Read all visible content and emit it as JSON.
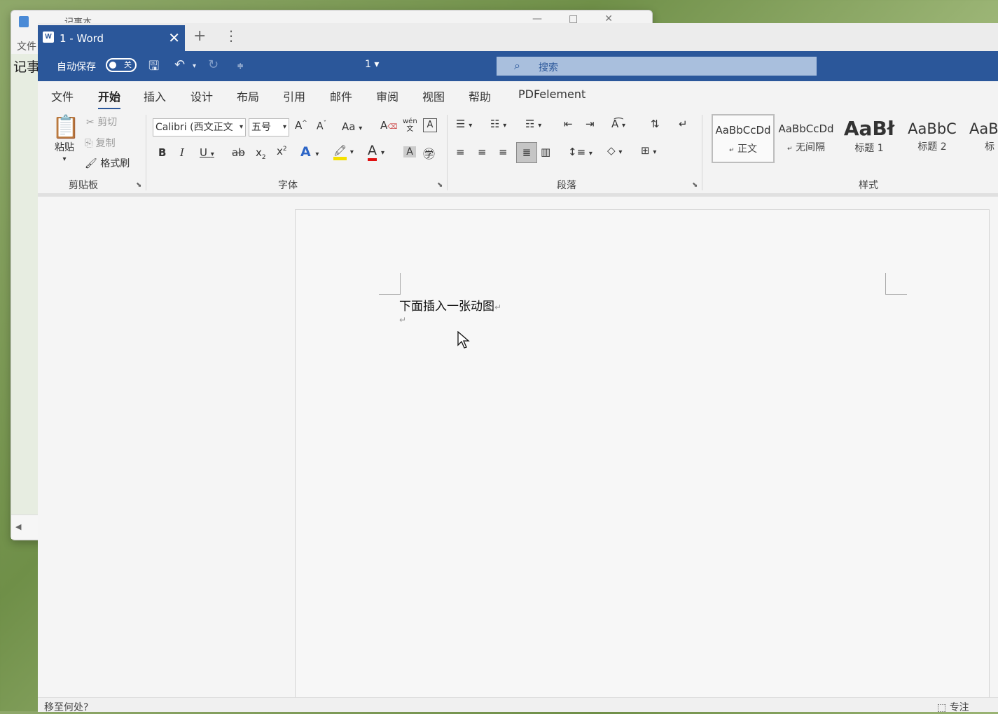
{
  "notepad": {
    "title": "记事本",
    "menu_file": "文件",
    "content_preview": "记事"
  },
  "word": {
    "tab_title": "1 - Word",
    "tab_icon_letter": "W",
    "autosave_label": "自动保存",
    "autosave_state": "关",
    "doc_name": "1",
    "search_placeholder": "搜索",
    "accent_color": "#2b579a",
    "menu": [
      "文件",
      "开始",
      "插入",
      "设计",
      "布局",
      "引用",
      "邮件",
      "审阅",
      "视图",
      "帮助",
      "PDFelement"
    ],
    "active_menu": "开始",
    "ribbon": {
      "clipboard": {
        "label": "剪贴板",
        "paste": "粘贴",
        "cut": "剪切",
        "copy": "复制",
        "format_painter": "格式刷"
      },
      "font": {
        "label": "字体",
        "font_name": "Calibri (西文正文",
        "font_size": "五号",
        "change_case": "Aa",
        "phonetic": "wén",
        "phonetic_sub": "文"
      },
      "paragraph": {
        "label": "段落"
      },
      "styles": {
        "label": "样式",
        "items": [
          {
            "sample": "AaBbCcDd",
            "name": "正文",
            "mark": "↵"
          },
          {
            "sample": "AaBbCcDd",
            "name": "无间隔",
            "mark": "↵"
          },
          {
            "sample": "AaBł",
            "name": "标题 1"
          },
          {
            "sample": "AaBbC",
            "name": "标题 2"
          },
          {
            "sample": "AaB",
            "name": "标"
          }
        ]
      }
    },
    "document": {
      "line1": "下面插入一张动图",
      "paragraph_mark": "↵"
    },
    "status": {
      "left": "移至何处?",
      "focus": "专注"
    }
  }
}
